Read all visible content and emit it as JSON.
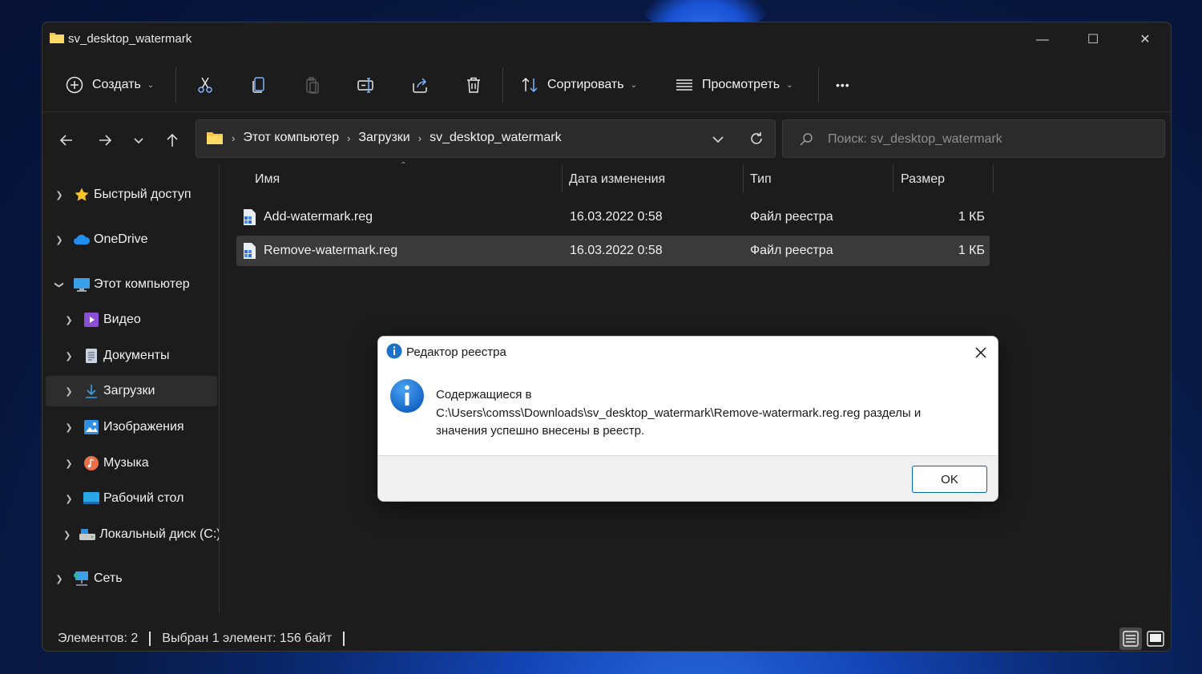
{
  "window": {
    "title": "sv_desktop_watermark",
    "minimize": "—",
    "maximize": "☐",
    "close": "✕"
  },
  "toolbar": {
    "create_label": "Создать",
    "sort_label": "Сортировать",
    "view_label": "Просмотреть",
    "more_label": "•••"
  },
  "address": {
    "crumbs": [
      "Этот компьютер",
      "Загрузки",
      "sv_desktop_watermark"
    ],
    "search_placeholder": "Поиск: sv_desktop_watermark"
  },
  "sidebar": {
    "items": [
      {
        "label": "Быстрый доступ",
        "icon": "star-icon"
      },
      {
        "label": "OneDrive",
        "icon": "cloud-icon"
      },
      {
        "label": "Этот компьютер",
        "icon": "computer-icon"
      },
      {
        "label": "Видео",
        "icon": "video-icon"
      },
      {
        "label": "Документы",
        "icon": "documents-icon"
      },
      {
        "label": "Загрузки",
        "icon": "downloads-icon"
      },
      {
        "label": "Изображения",
        "icon": "pictures-icon"
      },
      {
        "label": "Музыка",
        "icon": "music-icon"
      },
      {
        "label": "Рабочий стол",
        "icon": "desktop-icon"
      },
      {
        "label": "Локальный диск (C:)",
        "icon": "drive-icon"
      },
      {
        "label": "Сеть",
        "icon": "network-icon"
      }
    ]
  },
  "files": {
    "columns": [
      "Имя",
      "Дата изменения",
      "Тип",
      "Размер"
    ],
    "rows": [
      {
        "name": "Add-watermark.reg",
        "date": "16.03.2022 0:58",
        "type": "Файл реестра",
        "size": "1 КБ"
      },
      {
        "name": "Remove-watermark.reg",
        "date": "16.03.2022 0:58",
        "type": "Файл реестра",
        "size": "1 КБ"
      }
    ]
  },
  "status": {
    "count": "Элементов: 2",
    "selection": "Выбран 1 элемент: 156 байт"
  },
  "dialog": {
    "title": "Редактор реестра",
    "message_line1": "Содержащиеся в",
    "message_line2": "C:\\Users\\comss\\Downloads\\sv_desktop_watermark\\Remove-watermark.reg.reg разделы и",
    "message_line3": "значения успешно внесены в реестр.",
    "ok_label": "OK"
  },
  "colors": {
    "window_bg": "#1c1c1c",
    "accent": "#0067c0",
    "info_blue": "#1a73c8"
  }
}
